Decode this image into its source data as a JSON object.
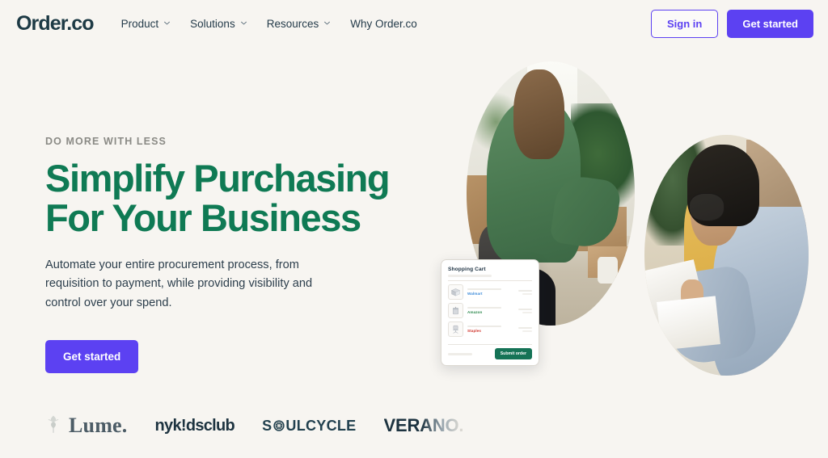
{
  "nav": {
    "logo": "Order.co",
    "links": [
      {
        "label": "Product",
        "has_chevron": true,
        "icon": "chevron-down-icon"
      },
      {
        "label": "Solutions",
        "has_chevron": true,
        "icon": "chevron-down-icon"
      },
      {
        "label": "Resources",
        "has_chevron": true,
        "icon": "chevron-down-icon"
      },
      {
        "label": "Why Order.co",
        "has_chevron": false,
        "icon": ""
      }
    ],
    "sign_in": "Sign in",
    "get_started": "Get started"
  },
  "hero": {
    "eyebrow": "DO MORE WITH LESS",
    "headline_line1": "Simplify Purchasing",
    "headline_line2": "For Your Business",
    "subcopy": "Automate your entire procurement process, from requisition to payment, while providing visibility and control over your spend.",
    "cta": "Get started"
  },
  "media": {
    "photo_woman_alt": "Woman in green shirt at desk with shipping boxes and plants",
    "photo_man_alt": "Man with glasses in light blue shirt reviewing paperwork"
  },
  "cart": {
    "title": "Shopping Cart",
    "items": [
      {
        "vendor": "Walmart",
        "vendor_color": "#3C8BD9",
        "thumb_icon": "box-icon"
      },
      {
        "vendor": "Amazon",
        "vendor_color": "#2F8A4F",
        "thumb_icon": "package-icon"
      },
      {
        "vendor": "Staples",
        "vendor_color": "#D0342C",
        "thumb_icon": "office-chair-icon"
      }
    ],
    "submit_label": "Submit order"
  },
  "logo_strip": {
    "brands": [
      {
        "name": "Lume.",
        "icon": "leaf-icon"
      },
      {
        "name": "nyk!dsclub",
        "icon": ""
      },
      {
        "name": "SOULCYCLE",
        "icon": "wheel-icon"
      },
      {
        "name": "VERANO.",
        "icon": ""
      }
    ]
  },
  "colors": {
    "background": "#F7F5F1",
    "accent_purple": "#5C41F2",
    "headline_green": "#0F7A54",
    "submit_green": "#157356",
    "navy": "#1D3A45"
  }
}
